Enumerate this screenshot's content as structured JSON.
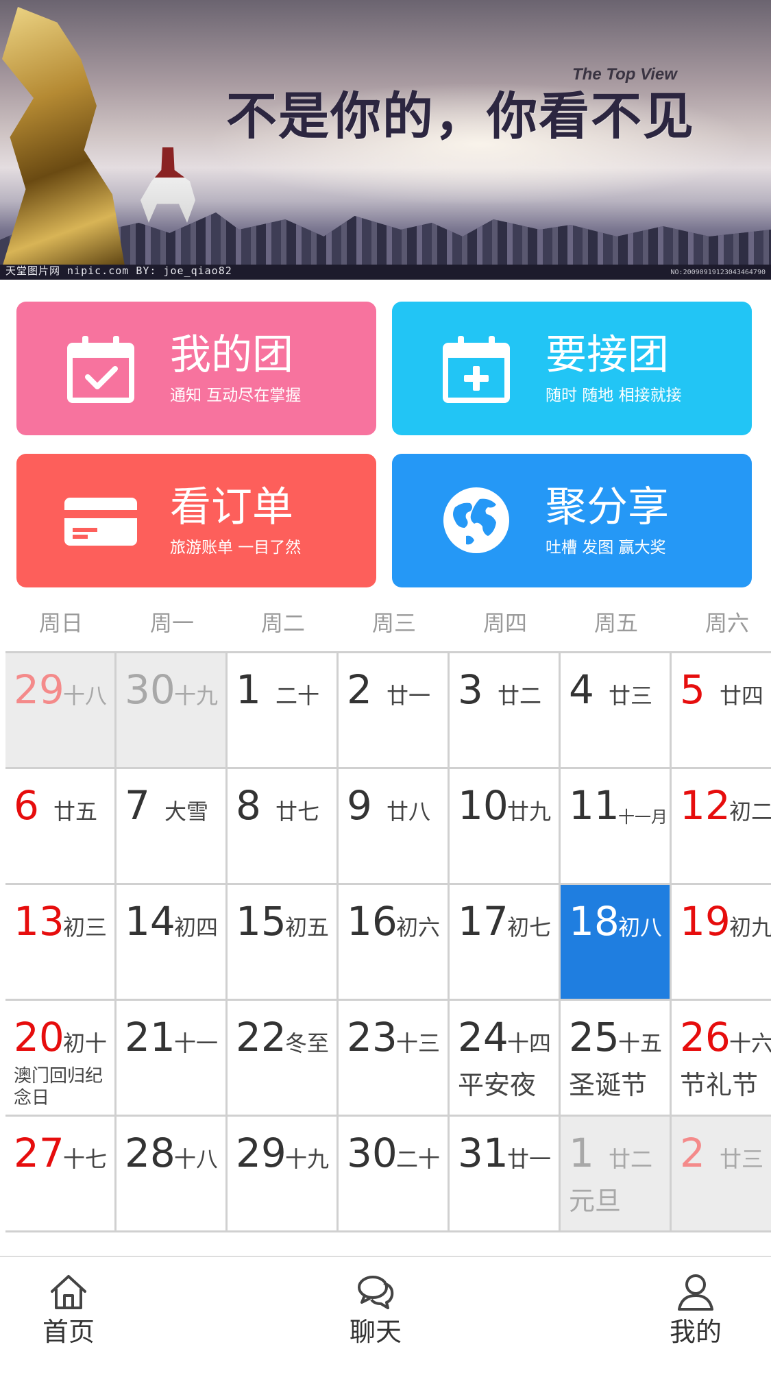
{
  "banner": {
    "slogan": "不是你的，你看不见",
    "tag": "The Top View",
    "footer_left": "天堂图片网 nipic.com   BY: joe_qiao82",
    "footer_right": "NO:20090919123043464790"
  },
  "tiles": [
    {
      "id": "my",
      "title": "我的团",
      "subtitle": "通知 互动尽在掌握",
      "icon": "calendar-check-icon",
      "color": "#f7739e"
    },
    {
      "id": "take",
      "title": "要接团",
      "subtitle": "随时 随地 相接就接",
      "icon": "calendar-plus-icon",
      "color": "#22c5f5"
    },
    {
      "id": "order",
      "title": "看订单",
      "subtitle": "旅游账单 一目了然",
      "icon": "credit-card-icon",
      "color": "#fd5f5b"
    },
    {
      "id": "share",
      "title": "聚分享",
      "subtitle": "吐槽 发图 赢大奖",
      "icon": "globe-icon",
      "color": "#2598f6"
    }
  ],
  "calendar": {
    "weekdays": [
      "周日",
      "周一",
      "周二",
      "周三",
      "周四",
      "周五",
      "周六"
    ],
    "rows": [
      [
        {
          "day": "29",
          "lunar": "十八",
          "state": "prev"
        },
        {
          "day": "30",
          "lunar": "十九",
          "state": "prev"
        },
        {
          "day": "1",
          "lunar": "二十"
        },
        {
          "day": "2",
          "lunar": "廿一"
        },
        {
          "day": "3",
          "lunar": "廿二"
        },
        {
          "day": "4",
          "lunar": "廿三"
        },
        {
          "day": "5",
          "lunar": "廿四",
          "weekend": true
        }
      ],
      [
        {
          "day": "6",
          "lunar": "廿五",
          "weekend": true
        },
        {
          "day": "7",
          "lunar": "大雪"
        },
        {
          "day": "8",
          "lunar": "廿七"
        },
        {
          "day": "9",
          "lunar": "廿八"
        },
        {
          "day": "10",
          "lunar": "廿九"
        },
        {
          "day": "11",
          "lunar": "十一月",
          "small": true
        },
        {
          "day": "12",
          "lunar": "初二",
          "weekend": true
        }
      ],
      [
        {
          "day": "13",
          "lunar": "初三",
          "weekend": true
        },
        {
          "day": "14",
          "lunar": "初四"
        },
        {
          "day": "15",
          "lunar": "初五"
        },
        {
          "day": "16",
          "lunar": "初六"
        },
        {
          "day": "17",
          "lunar": "初七"
        },
        {
          "day": "18",
          "lunar": "初八",
          "state": "today"
        },
        {
          "day": "19",
          "lunar": "初九",
          "weekend": true
        }
      ],
      [
        {
          "day": "20",
          "lunar": "初十",
          "weekend": true,
          "festival": "澳门回归纪念日",
          "festival_small": true
        },
        {
          "day": "21",
          "lunar": "十一"
        },
        {
          "day": "22",
          "lunar": "冬至"
        },
        {
          "day": "23",
          "lunar": "十三"
        },
        {
          "day": "24",
          "lunar": "十四",
          "festival": "平安夜"
        },
        {
          "day": "25",
          "lunar": "十五",
          "festival": "圣诞节"
        },
        {
          "day": "26",
          "lunar": "十六",
          "weekend": true,
          "festival": "节礼节"
        }
      ],
      [
        {
          "day": "27",
          "lunar": "十七",
          "weekend": true
        },
        {
          "day": "28",
          "lunar": "十八"
        },
        {
          "day": "29",
          "lunar": "十九"
        },
        {
          "day": "30",
          "lunar": "二十"
        },
        {
          "day": "31",
          "lunar": "廿一"
        },
        {
          "day": "1",
          "lunar": "廿二",
          "state": "next",
          "festival": "元旦"
        },
        {
          "day": "2",
          "lunar": "廿三",
          "state": "next",
          "weekend": true
        }
      ]
    ]
  },
  "nav": [
    {
      "id": "home",
      "label": "首页",
      "icon": "home-icon"
    },
    {
      "id": "chat",
      "label": "聊天",
      "icon": "chat-bubbles-icon"
    },
    {
      "id": "me",
      "label": "我的",
      "icon": "user-icon"
    }
  ]
}
